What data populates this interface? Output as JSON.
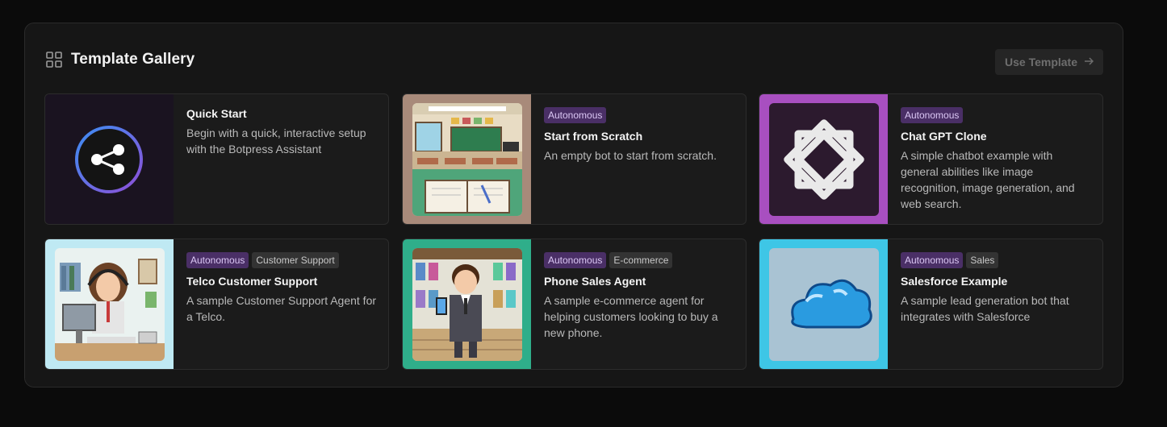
{
  "header": {
    "title": "Template Gallery",
    "icon": "grid-icon"
  },
  "actions": {
    "use_template": "Use Template",
    "arrow_icon": "arrow-right-icon"
  },
  "cards": [
    {
      "title": "Quick Start",
      "tags": [],
      "description": "Begin with a quick, interactive setup with the Botpress Assistant",
      "icon": "share-icon",
      "thumb_bg": "#1a1320"
    },
    {
      "title": "Start from Scratch",
      "tags": [
        "Autonomous"
      ],
      "description": "An empty bot to start from scratch.",
      "icon": "classroom-image",
      "thumb_bg": "#a88a7a"
    },
    {
      "title": "Chat GPT Clone",
      "tags": [
        "Autonomous"
      ],
      "description": "A simple chatbot example with general abilities like image recognition, image generation, and web search.",
      "icon": "openai-logo-image",
      "thumb_bg": "#a84fc0"
    },
    {
      "title": "Telco Customer Support",
      "tags": [
        "Autonomous",
        "Customer Support"
      ],
      "description": "A sample Customer Support Agent for a Telco.",
      "icon": "support-agent-image",
      "thumb_bg": "#bfe9f3"
    },
    {
      "title": "Phone Sales Agent",
      "tags": [
        "Autonomous",
        "E-commerce"
      ],
      "description": "A sample e-commerce agent for helping customers looking to buy a new phone.",
      "icon": "phone-salesman-image",
      "thumb_bg": "#2fae8a"
    },
    {
      "title": "Salesforce Example",
      "tags": [
        "Autonomous",
        "Sales"
      ],
      "description": "A sample lead generation bot that integrates with Salesforce",
      "icon": "cloud-image",
      "thumb_bg": "#3ec6e6"
    }
  ]
}
